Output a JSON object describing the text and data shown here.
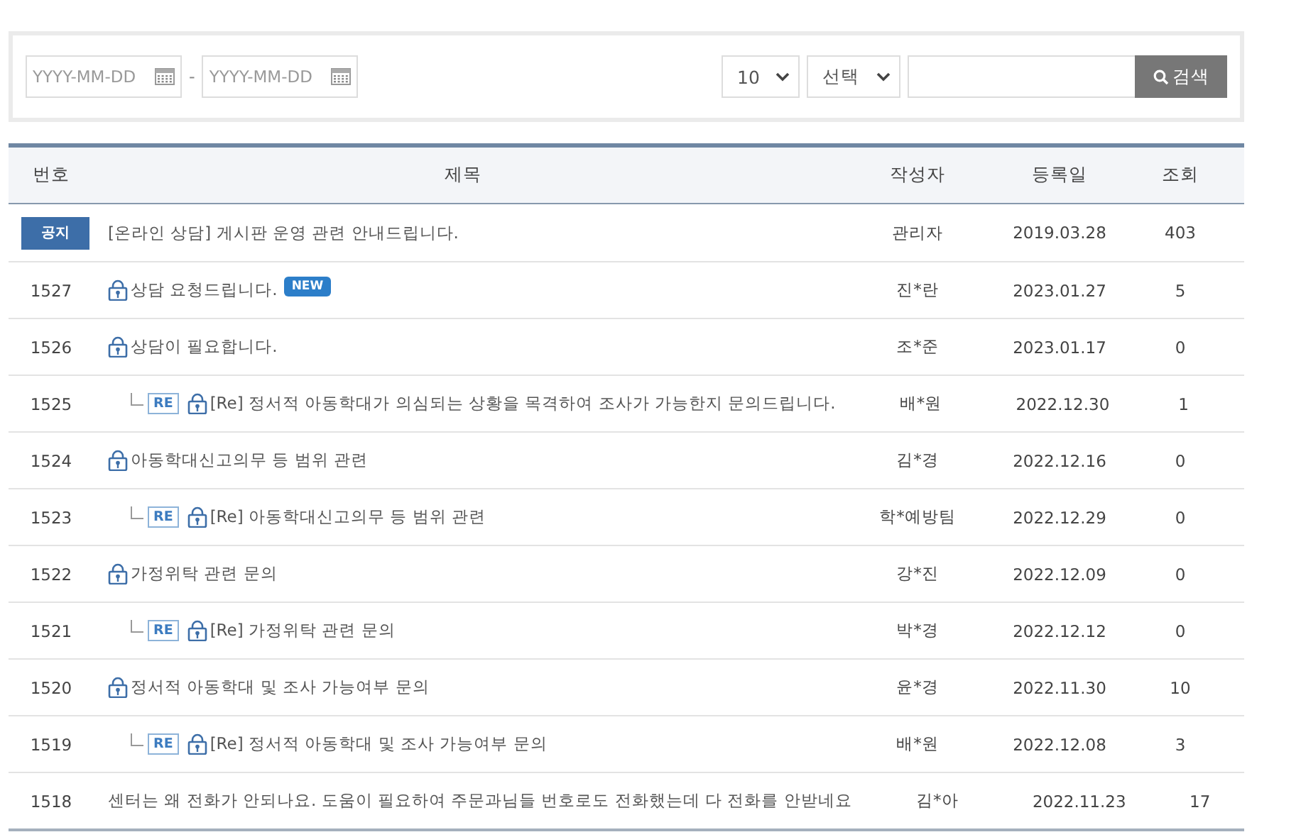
{
  "search": {
    "date_from": {
      "placeholder": "YYYY-MM-DD"
    },
    "separator": "-",
    "date_to": {
      "placeholder": "YYYY-MM-DD"
    },
    "page_size": "10",
    "field": "선택",
    "button": "검색"
  },
  "table": {
    "columns": [
      "번호",
      "제목",
      "작성자",
      "등록일",
      "조회"
    ],
    "rows": [
      {
        "kind": "notice",
        "number": "공지",
        "title": "[온라인 상담] 게시판 운영 관련 안내드립니다.",
        "locked": false,
        "new": false,
        "author": "관리자",
        "date": "2019.03.28",
        "views": "403"
      },
      {
        "kind": "post",
        "number": "1527",
        "title": "상담 요청드립니다.",
        "locked": true,
        "new": true,
        "new_label": "NEW",
        "author": "진*란",
        "date": "2023.01.27",
        "views": "5"
      },
      {
        "kind": "post",
        "number": "1526",
        "title": "상담이 필요합니다.",
        "locked": true,
        "new": false,
        "author": "조*준",
        "date": "2023.01.17",
        "views": "0"
      },
      {
        "kind": "reply",
        "number": "1525",
        "re_label": "RE",
        "title": "[Re] 정서적 아동학대가 의심되는 상황을 목격하여 조사가 가능한지 문의드립니다.",
        "locked": true,
        "new": false,
        "author": "배*원",
        "date": "2022.12.30",
        "views": "1"
      },
      {
        "kind": "post",
        "number": "1524",
        "title": "아동학대신고의무 등 범위 관련",
        "locked": true,
        "new": false,
        "author": "김*경",
        "date": "2022.12.16",
        "views": "0"
      },
      {
        "kind": "reply",
        "number": "1523",
        "re_label": "RE",
        "title": "[Re] 아동학대신고의무 등 범위 관련",
        "locked": true,
        "new": false,
        "author": "학*예방팀",
        "date": "2022.12.29",
        "views": "0"
      },
      {
        "kind": "post",
        "number": "1522",
        "title": "가정위탁 관련 문의",
        "locked": true,
        "new": false,
        "author": "강*진",
        "date": "2022.12.09",
        "views": "0"
      },
      {
        "kind": "reply",
        "number": "1521",
        "re_label": "RE",
        "title": "[Re] 가정위탁 관련 문의",
        "locked": true,
        "new": false,
        "author": "박*경",
        "date": "2022.12.12",
        "views": "0"
      },
      {
        "kind": "post",
        "number": "1520",
        "title": "정서적 아동학대 및 조사 가능여부 문의",
        "locked": true,
        "new": false,
        "author": "윤*경",
        "date": "2022.11.30",
        "views": "10"
      },
      {
        "kind": "reply",
        "number": "1519",
        "re_label": "RE",
        "title": "[Re] 정서적 아동학대 및 조사 가능여부 문의",
        "locked": true,
        "new": false,
        "author": "배*원",
        "date": "2022.12.08",
        "views": "3"
      },
      {
        "kind": "post",
        "number": "1518",
        "title": "센터는 왜 전화가 안되나요. 도움이 필요하여 주문과님들 번호로도 전화했는데 다 전화를 안받네요",
        "locked": false,
        "new": false,
        "author": "김*아",
        "date": "2022.11.23",
        "views": "17"
      }
    ]
  }
}
